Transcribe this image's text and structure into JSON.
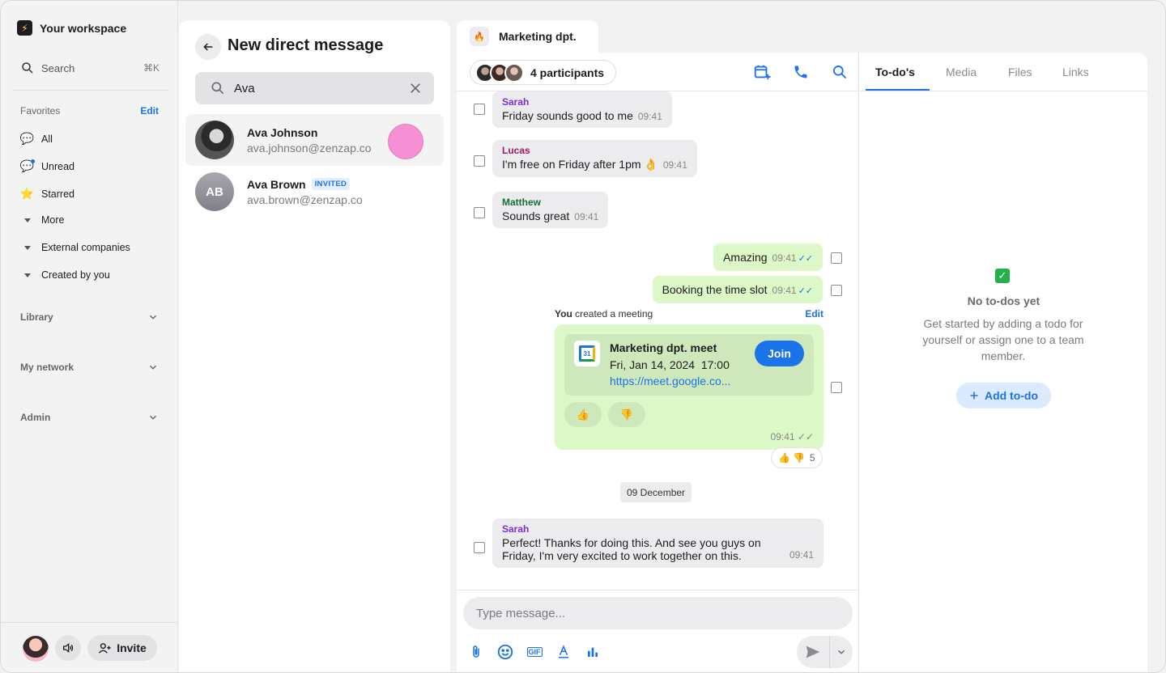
{
  "workspace": {
    "name": "Your workspace"
  },
  "sidebar": {
    "search_label": "Search",
    "search_shortcut": "⌘K",
    "favorites_label": "Favorites",
    "favorites_edit": "Edit",
    "items": [
      {
        "label": "All",
        "icon": "chat-bubble-icon"
      },
      {
        "label": "Unread",
        "icon": "unread-chat-icon"
      },
      {
        "label": "Starred",
        "icon": "star-icon"
      },
      {
        "label": "More",
        "icon": "caret-down-icon"
      },
      {
        "label": "External companies",
        "icon": "caret-down-icon"
      },
      {
        "label": "Created by you",
        "icon": "caret-down-icon"
      }
    ],
    "sections": [
      "Library",
      "My network",
      "Admin"
    ],
    "invite_label": "Invite"
  },
  "new_dm": {
    "title": "New direct message",
    "search_value": "Ava",
    "contacts": [
      {
        "name": "Ava Johnson",
        "email": "ava.johnson@zenzap.co",
        "badge": ""
      },
      {
        "name": "Ava Brown",
        "email": "ava.brown@zenzap.co",
        "badge": "INVITED",
        "initials": "AB"
      }
    ]
  },
  "chat": {
    "tab_title": "Marketing dpt.",
    "participants_label": "4 participants",
    "messages": [
      {
        "sender": "Sarah",
        "text": "Friday sounds good to me",
        "time": "09:41"
      },
      {
        "sender": "Lucas",
        "text": "I'm free on Friday after 1pm 👌",
        "time": "09:41"
      },
      {
        "sender": "Matthew",
        "text": "Sounds great",
        "time": "09:41"
      },
      {
        "text": "Amazing",
        "time": "09:41"
      },
      {
        "text": "Booking the time slot",
        "time": "09:41"
      }
    ],
    "meeting": {
      "creator": "You",
      "action": " created a meeting",
      "edit": "Edit",
      "title": "Marketing dpt. meet",
      "datetime": "Fri, Jan 14, 2024  17:00",
      "link": "https://meet.google.co...",
      "join": "Join",
      "calendar_day": "31",
      "time": "09:41",
      "reaction_count": "5"
    },
    "date_divider": "09 December",
    "last_message": {
      "sender": "Sarah",
      "line1": "Perfect! Thanks for doing this. And see you guys on",
      "line2": "Friday, I'm very excited to work together on this.",
      "time": "09:41"
    },
    "composer_placeholder": "Type message..."
  },
  "side_panel": {
    "tabs": [
      "To-do's",
      "Media",
      "Files",
      "Links"
    ],
    "empty_title": "No to-dos yet",
    "empty_text": "Get started by adding a todo for yourself or assign one to a team member.",
    "add_label": "Add to-do"
  },
  "colors": {
    "accent": "#1a73e8",
    "outgoing_bubble": "#dcf8c6",
    "incoming_bubble": "#ececee",
    "sarah": "#7b2fd6",
    "lucas": "#a3166b",
    "matthew": "#1d6b3a"
  }
}
